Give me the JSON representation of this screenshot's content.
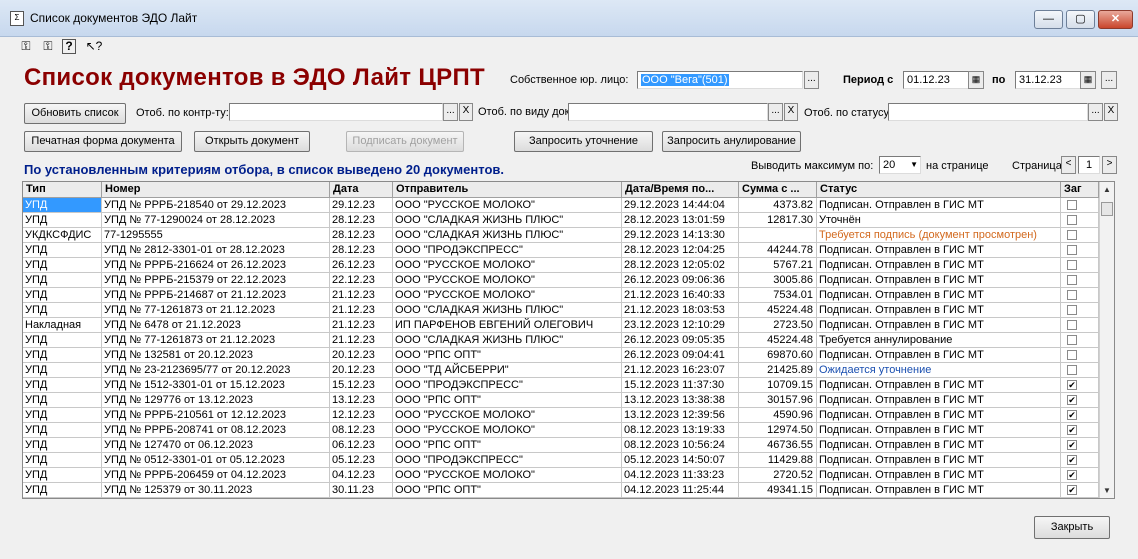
{
  "window": {
    "title": "Список документов ЭДО Лайт",
    "app_icon": "document-app-icon",
    "min": "—",
    "max": "▢",
    "close": "✕"
  },
  "toolbar": {
    "icons": [
      "user-lock-icon",
      "user-unlock-icon",
      "help-icon",
      "context-help-icon"
    ],
    "glyphs": [
      "⚿",
      "⚿",
      "?",
      "↖?"
    ]
  },
  "header": {
    "title": "Список документов в ЭДО Лайт ЦРПТ",
    "entity_label": "Собственное юр. лицо:",
    "entity_value": "ООО \"Вега\"(501)",
    "period_label": "Период с",
    "period_from": "01.12.23",
    "period_to_label": "по",
    "period_to": "31.12.23",
    "ellipsis": "..."
  },
  "filters": {
    "refresh_label": "Обновить список",
    "contractor_label": "Отоб. по контр-ту:",
    "contractor_value": "",
    "doctype_label": "Отоб. по виду док:",
    "doctype_value": "",
    "status_label": "Отоб. по статусу:",
    "status_value": "",
    "clear": "X"
  },
  "actions": {
    "print": "Печатная форма документа",
    "open": "Открыть документ",
    "sign": "Подписать документ",
    "clarify": "Запросить уточнение",
    "annul": "Запросить анулирование"
  },
  "info": {
    "criteria": "По установленным критериям отбора, в список выведено 20 документов.",
    "max_label": "Выводить максимум по:",
    "max_value": "20",
    "per_page": "на странице",
    "page_label": "Страница",
    "page_value": "1",
    "prev": "<",
    "next": ">"
  },
  "colors": {
    "title": "#8b0000",
    "criteria": "#001f8c",
    "selected": "#3399ff",
    "status_warning": "#d2691e",
    "status_pending": "#1a4fb0"
  },
  "table": {
    "columns": [
      "Тип",
      "Номер",
      "Дата",
      "Отправитель",
      "Дата/Время по...",
      "Сумма с ...",
      "Статус",
      "Заг"
    ],
    "rows": [
      {
        "type": "УПД",
        "number": "УПД № РРРБ-218540 от 29.12.2023",
        "date": "29.12.23",
        "sender": "ООО \"РУССКОЕ МОЛОКО\"",
        "datetime": "29.12.2023 14:44:04",
        "sum": "4373.82",
        "status": "Подписан. Отправлен в ГИС МТ",
        "status_kind": "normal",
        "loaded": false
      },
      {
        "type": "УПД",
        "number": "УПД № 77-1290024 от 28.12.2023",
        "date": "28.12.23",
        "sender": "ООО \"СЛАДКАЯ ЖИЗНЬ ПЛЮС\"",
        "datetime": "28.12.2023 13:01:59",
        "sum": "12817.30",
        "status": "Уточнён",
        "status_kind": "normal",
        "loaded": false
      },
      {
        "type": "УКДКСФДИС",
        "number": "77-1295555",
        "date": "28.12.23",
        "sender": "ООО \"СЛАДКАЯ ЖИЗНЬ ПЛЮС\"",
        "datetime": "29.12.2023 14:13:30",
        "sum": "",
        "status": "Требуется подпись (документ просмотрен)",
        "status_kind": "warning",
        "loaded": false
      },
      {
        "type": "УПД",
        "number": "УПД № 2812-3301-01 от 28.12.2023",
        "date": "28.12.23",
        "sender": "ООО \"ПРОДЭКСПРЕСС\"",
        "datetime": "28.12.2023 12:04:25",
        "sum": "44244.78",
        "status": "Подписан. Отправлен в ГИС МТ",
        "status_kind": "normal",
        "loaded": false
      },
      {
        "type": "УПД",
        "number": "УПД № РРРБ-216624 от 26.12.2023",
        "date": "26.12.23",
        "sender": "ООО \"РУССКОЕ МОЛОКО\"",
        "datetime": "28.12.2023 12:05:02",
        "sum": "5767.21",
        "status": "Подписан. Отправлен в ГИС МТ",
        "status_kind": "normal",
        "loaded": false
      },
      {
        "type": "УПД",
        "number": "УПД № РРРБ-215379 от 22.12.2023",
        "date": "22.12.23",
        "sender": "ООО \"РУССКОЕ МОЛОКО\"",
        "datetime": "26.12.2023 09:06:36",
        "sum": "3005.86",
        "status": "Подписан. Отправлен в ГИС МТ",
        "status_kind": "normal",
        "loaded": false
      },
      {
        "type": "УПД",
        "number": "УПД № РРРБ-214687 от 21.12.2023",
        "date": "21.12.23",
        "sender": "ООО \"РУССКОЕ МОЛОКО\"",
        "datetime": "21.12.2023 16:40:33",
        "sum": "7534.01",
        "status": "Подписан. Отправлен в ГИС МТ",
        "status_kind": "normal",
        "loaded": false
      },
      {
        "type": "УПД",
        "number": "УПД № 77-1261873 от 21.12.2023",
        "date": "21.12.23",
        "sender": "ООО \"СЛАДКАЯ ЖИЗНЬ ПЛЮС\"",
        "datetime": "21.12.2023 18:03:53",
        "sum": "45224.48",
        "status": "Подписан. Отправлен в ГИС МТ",
        "status_kind": "normal",
        "loaded": false
      },
      {
        "type": "Накладная",
        "number": "УПД № 6478 от 21.12.2023",
        "date": "21.12.23",
        "sender": "ИП ПАРФЕНОВ ЕВГЕНИЙ ОЛЕГОВИЧ",
        "datetime": "23.12.2023 12:10:29",
        "sum": "2723.50",
        "status": "Подписан. Отправлен в ГИС МТ",
        "status_kind": "normal",
        "loaded": false
      },
      {
        "type": "УПД",
        "number": "УПД № 77-1261873 от 21.12.2023",
        "date": "21.12.23",
        "sender": "ООО \"СЛАДКАЯ ЖИЗНЬ ПЛЮС\"",
        "datetime": "26.12.2023 09:05:35",
        "sum": "45224.48",
        "status": "Требуется аннулирование",
        "status_kind": "normal",
        "loaded": false
      },
      {
        "type": "УПД",
        "number": "УПД № 132581 от 20.12.2023",
        "date": "20.12.23",
        "sender": "ООО \"РПС ОПТ\"",
        "datetime": "26.12.2023 09:04:41",
        "sum": "69870.60",
        "status": "Подписан. Отправлен в ГИС МТ",
        "status_kind": "normal",
        "loaded": false
      },
      {
        "type": "УПД",
        "number": "УПД № 23-2123695/77 от 20.12.2023",
        "date": "20.12.23",
        "sender": "ООО \"ТД АЙСБЕРРИ\"",
        "datetime": "21.12.2023 16:23:07",
        "sum": "21425.89",
        "status": "Ожидается уточнение",
        "status_kind": "pending",
        "loaded": false
      },
      {
        "type": "УПД",
        "number": "УПД № 1512-3301-01 от 15.12.2023",
        "date": "15.12.23",
        "sender": "ООО \"ПРОДЭКСПРЕСС\"",
        "datetime": "15.12.2023 11:37:30",
        "sum": "10709.15",
        "status": "Подписан. Отправлен в ГИС МТ",
        "status_kind": "normal",
        "loaded": true
      },
      {
        "type": "УПД",
        "number": "УПД № 129776 от 13.12.2023",
        "date": "13.12.23",
        "sender": "ООО \"РПС ОПТ\"",
        "datetime": "13.12.2023 13:38:38",
        "sum": "30157.96",
        "status": "Подписан. Отправлен в ГИС МТ",
        "status_kind": "normal",
        "loaded": true
      },
      {
        "type": "УПД",
        "number": "УПД № РРРБ-210561 от 12.12.2023",
        "date": "12.12.23",
        "sender": "ООО \"РУССКОЕ МОЛОКО\"",
        "datetime": "13.12.2023 12:39:56",
        "sum": "4590.96",
        "status": "Подписан. Отправлен в ГИС МТ",
        "status_kind": "normal",
        "loaded": true
      },
      {
        "type": "УПД",
        "number": "УПД № РРРБ-208741 от 08.12.2023",
        "date": "08.12.23",
        "sender": "ООО \"РУССКОЕ МОЛОКО\"",
        "datetime": "08.12.2023 13:19:33",
        "sum": "12974.50",
        "status": "Подписан. Отправлен в ГИС МТ",
        "status_kind": "normal",
        "loaded": true
      },
      {
        "type": "УПД",
        "number": "УПД № 127470 от 06.12.2023",
        "date": "06.12.23",
        "sender": "ООО \"РПС ОПТ\"",
        "datetime": "08.12.2023 10:56:24",
        "sum": "46736.55",
        "status": "Подписан. Отправлен в ГИС МТ",
        "status_kind": "normal",
        "loaded": true
      },
      {
        "type": "УПД",
        "number": "УПД № 0512-3301-01 от 05.12.2023",
        "date": "05.12.23",
        "sender": "ООО \"ПРОДЭКСПРЕСС\"",
        "datetime": "05.12.2023 14:50:07",
        "sum": "11429.88",
        "status": "Подписан. Отправлен в ГИС МТ",
        "status_kind": "normal",
        "loaded": true
      },
      {
        "type": "УПД",
        "number": "УПД № РРРБ-206459 от 04.12.2023",
        "date": "04.12.23",
        "sender": "ООО \"РУССКОЕ МОЛОКО\"",
        "datetime": "04.12.2023 11:33:23",
        "sum": "2720.52",
        "status": "Подписан. Отправлен в ГИС МТ",
        "status_kind": "normal",
        "loaded": true
      },
      {
        "type": "УПД",
        "number": "УПД № 125379 от 30.11.2023",
        "date": "30.11.23",
        "sender": "ООО \"РПС ОПТ\"",
        "datetime": "04.12.2023 11:25:44",
        "sum": "49341.15",
        "status": "Подписан. Отправлен в ГИС МТ",
        "status_kind": "normal",
        "loaded": true
      }
    ],
    "checked_glyph": "✔",
    "scroll_up": "▲",
    "scroll_down": "▼"
  },
  "footer": {
    "close_label": "Закрыть"
  }
}
